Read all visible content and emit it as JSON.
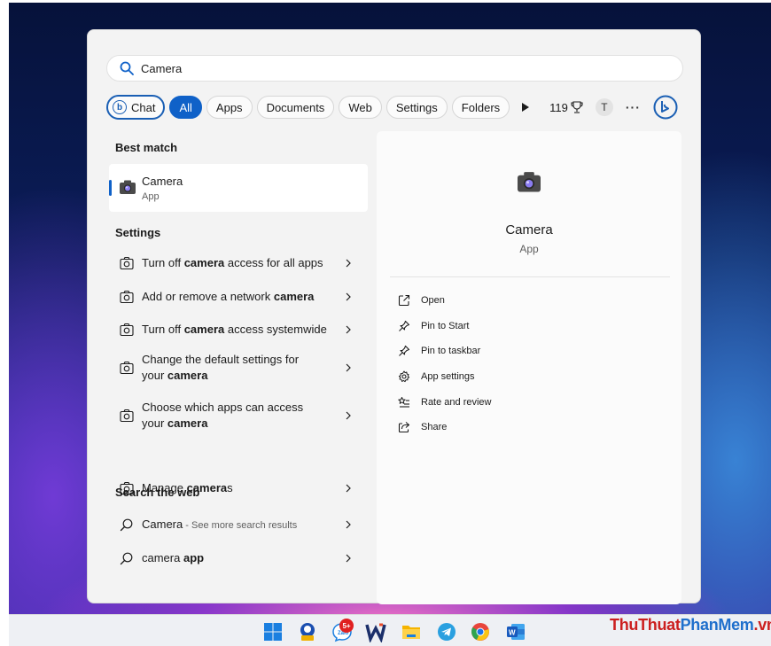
{
  "search": {
    "value": "Camera"
  },
  "filters": [
    {
      "label": "Chat"
    },
    {
      "label": "All"
    },
    {
      "label": "Apps"
    },
    {
      "label": "Documents"
    },
    {
      "label": "Web"
    },
    {
      "label": "Settings"
    },
    {
      "label": "Folders"
    }
  ],
  "header_right": {
    "points": "119",
    "avatar_letter": "T"
  },
  "best_match": {
    "title": "Best match",
    "name": "Camera",
    "type": "App"
  },
  "settings": {
    "title": "Settings",
    "items": [
      {
        "pre": "Turn off ",
        "bold": "camera",
        "post": " access for all apps"
      },
      {
        "pre": "Add or remove a network ",
        "bold": "camera",
        "post": ""
      },
      {
        "pre": "Turn off ",
        "bold": "camera",
        "post": " access systemwide"
      },
      {
        "line1": "Change the default settings for",
        "pre2": "your ",
        "bold": "camera"
      },
      {
        "line1": "Choose which apps can access",
        "pre2": "your ",
        "bold": "camera"
      },
      {
        "pre": "Manage ",
        "bold": "camera",
        "post": "s"
      }
    ]
  },
  "web": {
    "title": "Search the web",
    "items": [
      {
        "main": "Camera",
        "sub": " - See more search results"
      },
      {
        "pre": "camera ",
        "bold": "app"
      }
    ]
  },
  "preview": {
    "name": "Camera",
    "type": "App",
    "actions": [
      {
        "label": "Open",
        "icon": "open-external-icon"
      },
      {
        "label": "Pin to Start",
        "icon": "pin-icon"
      },
      {
        "label": "Pin to taskbar",
        "icon": "pin-icon"
      },
      {
        "label": "App settings",
        "icon": "gear-icon"
      },
      {
        "label": "Rate and review",
        "icon": "star-list-icon"
      },
      {
        "label": "Share",
        "icon": "share-icon"
      }
    ]
  },
  "taskbar": {
    "zalo_badge": "5+"
  },
  "watermark": {
    "part1": "ThuThuat",
    "part2": "PhanMem",
    "part3": ".vn"
  },
  "colors": {
    "accent": "#0f61c8",
    "panel_bg": "#f3f3f3",
    "preview_bg": "#fbfbfb"
  }
}
